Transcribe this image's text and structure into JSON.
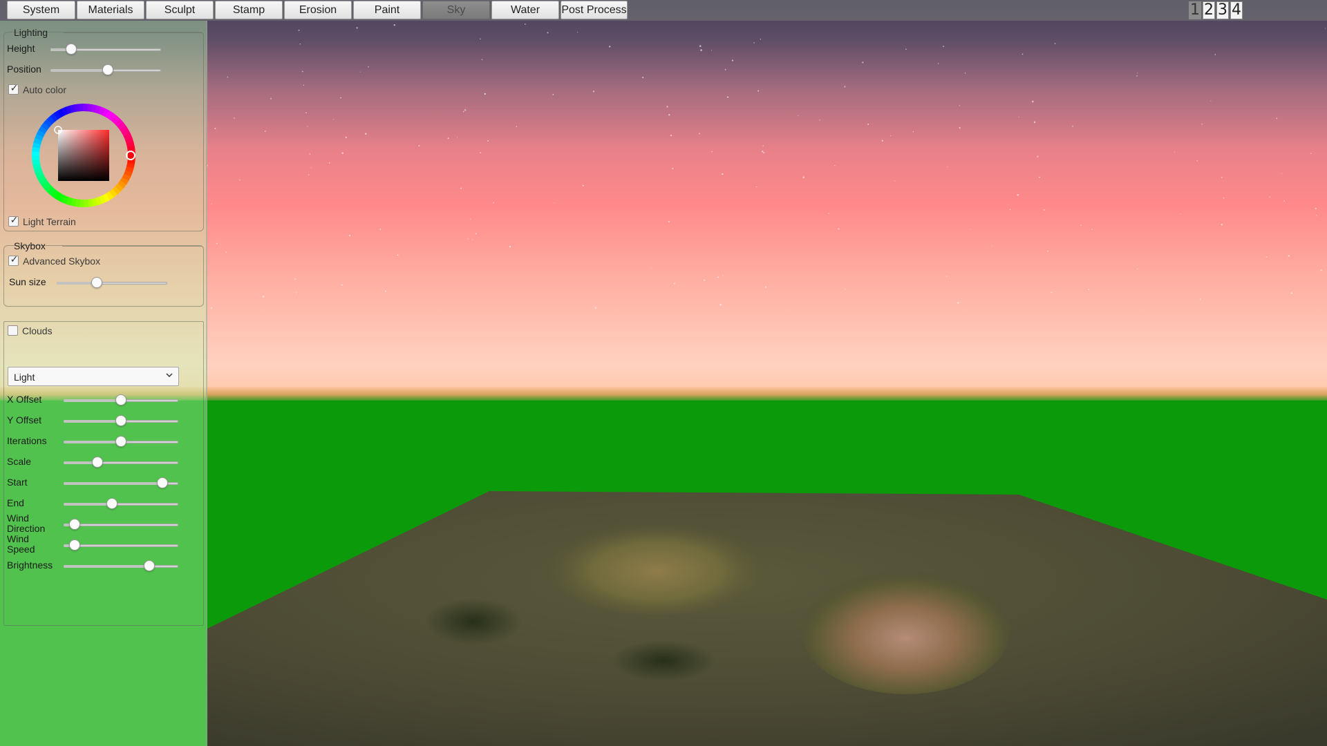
{
  "menu": {
    "tabs": [
      {
        "label": "System",
        "active": false
      },
      {
        "label": "Materials",
        "active": false
      },
      {
        "label": "Sculpt",
        "active": false
      },
      {
        "label": "Stamp",
        "active": false
      },
      {
        "label": "Erosion",
        "active": false
      },
      {
        "label": "Paint",
        "active": false
      },
      {
        "label": "Sky",
        "active": true
      },
      {
        "label": "Water",
        "active": false
      },
      {
        "label": "Post Process",
        "active": false
      }
    ],
    "view_buttons": [
      {
        "label": "1",
        "active": true
      },
      {
        "label": "2",
        "active": false
      },
      {
        "label": "3",
        "active": false
      },
      {
        "label": "4",
        "active": false
      }
    ]
  },
  "lighting": {
    "title": "Lighting",
    "height": {
      "label": "Height",
      "value": 0.15
    },
    "position": {
      "label": "Position",
      "value": 0.52
    },
    "auto_color": {
      "label": "Auto color",
      "checked": true
    },
    "color_picker": {
      "selected_hue_color": "#ff2b2b"
    },
    "light_terrain": {
      "label": "Light Terrain",
      "checked": true
    }
  },
  "skybox": {
    "title": "Skybox",
    "advanced_skybox": {
      "label": "Advanced Skybox",
      "checked": true
    },
    "sun_size": {
      "label": "Sun size",
      "value": 0.35
    }
  },
  "clouds": {
    "enabled": {
      "label": "Clouds",
      "checked": false
    },
    "preset": {
      "selected": "Light"
    },
    "sliders": [
      {
        "label": "X Offset",
        "value": 0.5
      },
      {
        "label": "Y Offset",
        "value": 0.5
      },
      {
        "label": "Iterations",
        "value": 0.5
      },
      {
        "label": "Scale",
        "value": 0.27
      },
      {
        "label": "Start",
        "value": 0.9
      },
      {
        "label": "End",
        "value": 0.41
      },
      {
        "label": "Wind Direction",
        "value": 0.05
      },
      {
        "label": "Wind Speed",
        "value": 0.05
      },
      {
        "label": "Brightness",
        "value": 0.77
      }
    ]
  },
  "colors": {
    "menubar": "#8a8a8a",
    "active_tab": "#7a7a7a",
    "panel_tint": "#bfffb4",
    "sky_top": "#47475a",
    "sky_glow": "#ff8888",
    "horizon": "#ffcbb5",
    "ground": "#0a9a0a"
  },
  "icons": {
    "checkmark": "checkmark-icon",
    "dropdown": "chevron-down-icon"
  }
}
